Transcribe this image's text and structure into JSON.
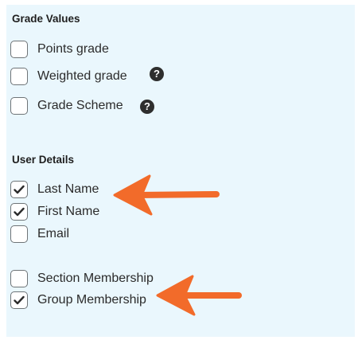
{
  "grade_values": {
    "title": "Grade Values",
    "options": [
      {
        "label": "Points grade",
        "checked": false,
        "help": false
      },
      {
        "label": "Weighted grade",
        "checked": false,
        "help": true,
        "help_icon": "question-circle-icon"
      },
      {
        "label": "Grade Scheme",
        "checked": false,
        "help": true,
        "help_icon": "question-circle-icon"
      }
    ]
  },
  "user_details": {
    "title": "User Details",
    "options": [
      {
        "label": "Last Name",
        "checked": true
      },
      {
        "label": "First Name",
        "checked": true
      },
      {
        "label": "Email",
        "checked": false
      },
      {
        "label": "Section Membership",
        "checked": false
      },
      {
        "label": "Group Membership",
        "checked": true
      }
    ]
  },
  "colors": {
    "panel_background": "#eaf7fd",
    "annotation_arrow": "#f26b2a",
    "checkbox_border": "#6e7477"
  },
  "annotations": [
    {
      "type": "arrow-icon",
      "points_to": "Last Name / First Name"
    },
    {
      "type": "arrow-icon",
      "points_to": "Group Membership"
    }
  ]
}
